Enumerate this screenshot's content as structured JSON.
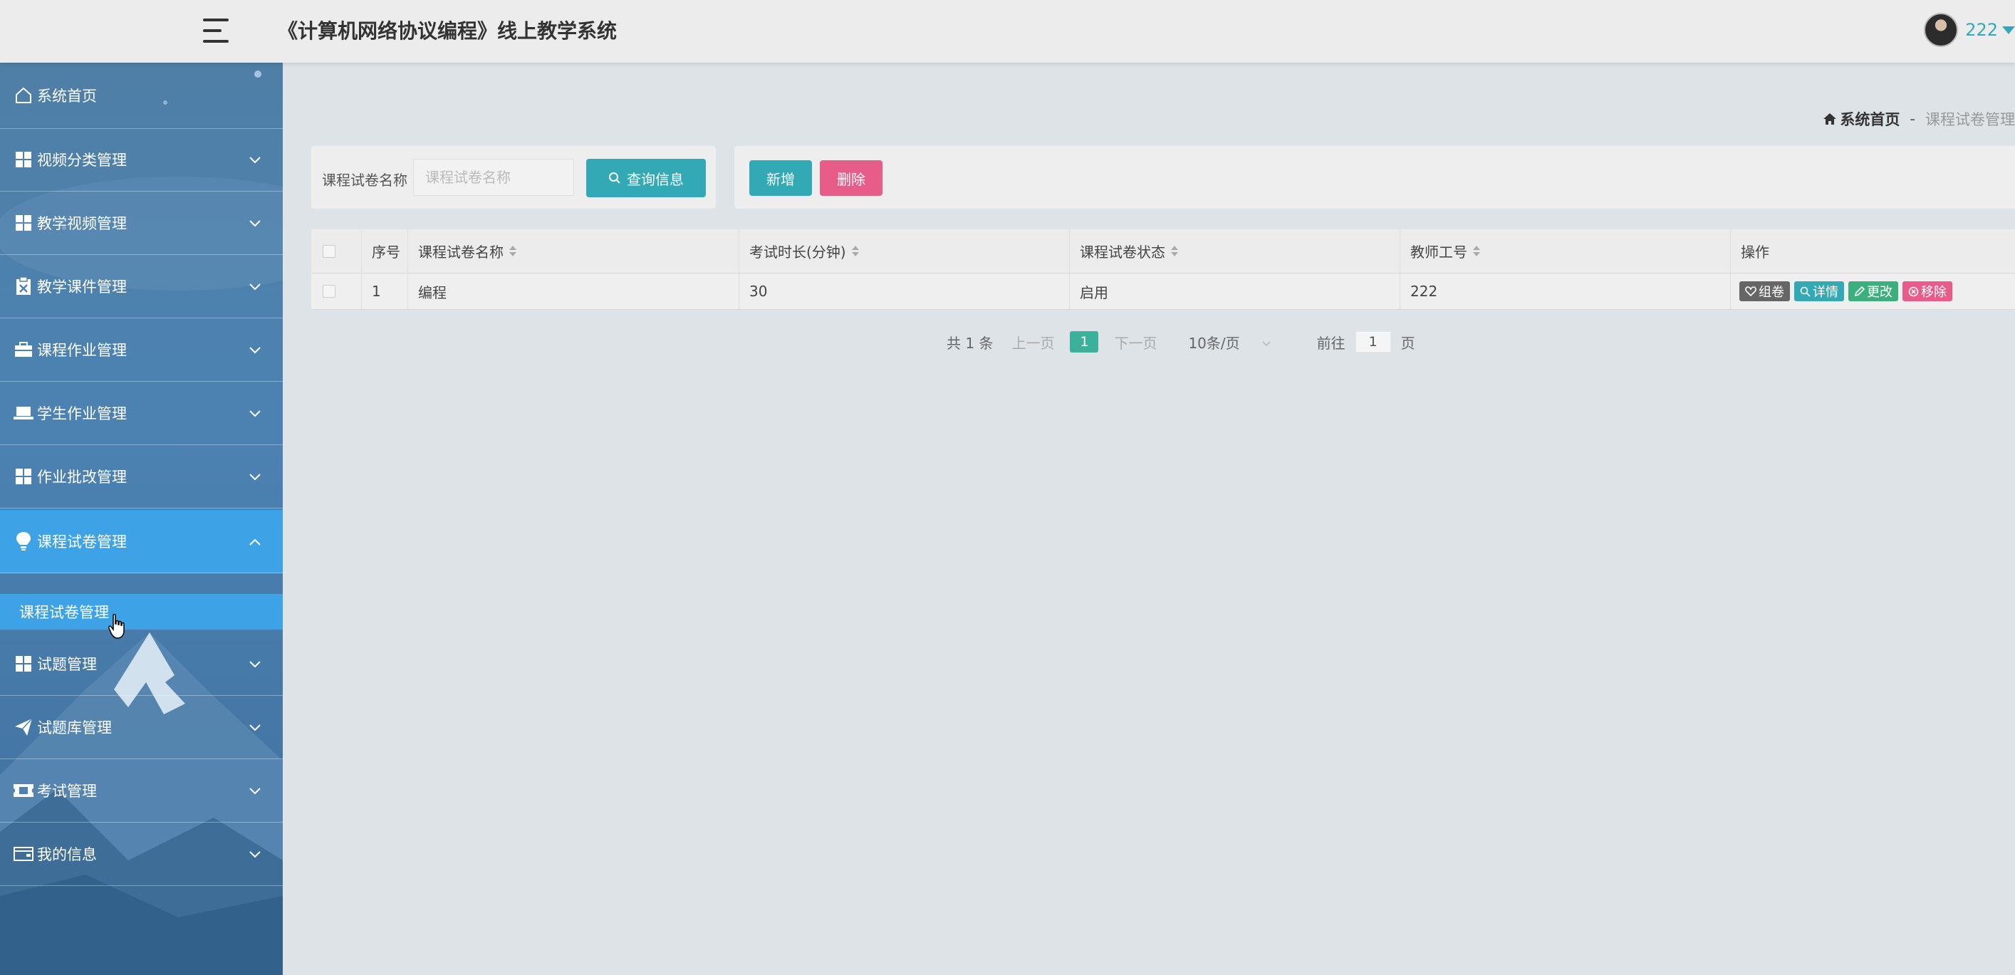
{
  "header": {
    "app_title": "《计算机网络协议编程》线上教学系统",
    "user_name": "222"
  },
  "sidebar": {
    "items": [
      {
        "label": "系统首页",
        "icon": "home-icon"
      },
      {
        "label": "视频分类管理",
        "icon": "grid-icon"
      },
      {
        "label": "教学视频管理",
        "icon": "grid-icon"
      },
      {
        "label": "教学课件管理",
        "icon": "clipboard-icon"
      },
      {
        "label": "课程作业管理",
        "icon": "briefcase-icon"
      },
      {
        "label": "学生作业管理",
        "icon": "laptop-icon"
      },
      {
        "label": "作业批改管理",
        "icon": "grid-icon"
      },
      {
        "label": "课程试卷管理",
        "icon": "bulb-icon",
        "expanded": true
      },
      {
        "label": "试题管理",
        "icon": "grid-icon"
      },
      {
        "label": "试题库管理",
        "icon": "send-icon"
      },
      {
        "label": "考试管理",
        "icon": "ticket-icon"
      },
      {
        "label": "我的信息",
        "icon": "wallet-icon"
      }
    ],
    "sub_item": "课程试卷管理"
  },
  "breadcrumb": {
    "home": "系统首页",
    "separator": "-",
    "current": "课程试卷管理"
  },
  "search": {
    "label": "课程试卷名称",
    "placeholder": "课程试卷名称",
    "button": "查询信息"
  },
  "actions": {
    "add": "新增",
    "delete": "删除"
  },
  "table": {
    "columns": [
      "序号",
      "课程试卷名称",
      "考试时长(分钟)",
      "课程试卷状态",
      "教师工号",
      "操作"
    ],
    "rows": [
      {
        "index": "1",
        "name": "编程",
        "duration": "30",
        "status": "启用",
        "teacher_id": "222"
      }
    ],
    "ops": {
      "group": "组卷",
      "detail": "详情",
      "edit": "更改",
      "remove": "移除"
    }
  },
  "pagination": {
    "total": "共 1 条",
    "prev": "上一页",
    "page": "1",
    "next": "下一页",
    "page_size": "10条/页",
    "goto_prefix": "前往",
    "goto_value": "1",
    "goto_suffix": "页"
  },
  "colors": {
    "accent": "#33a9b5",
    "danger": "#e85c8a",
    "success": "#3bb07e",
    "sidebar_active": "#3ea3e6"
  }
}
